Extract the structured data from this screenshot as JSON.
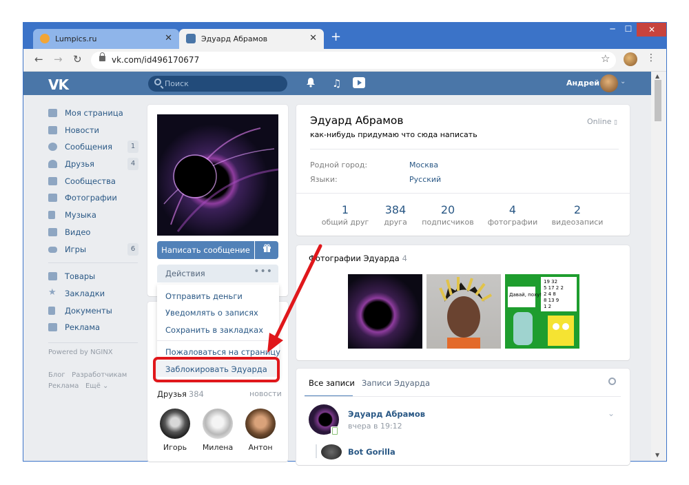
{
  "browser": {
    "tabs": [
      {
        "title": "Lumpics.ru",
        "close": "✕"
      },
      {
        "title": "Эдуард Абрамов",
        "close": "✕"
      }
    ],
    "new_tab": "+",
    "url": "vk.com/id496170677",
    "window_controls": [
      "─",
      "☐",
      "✕"
    ]
  },
  "vk_header": {
    "logo": "VK",
    "search_placeholder": "Поиск",
    "user_name": "Андрей"
  },
  "sidebar": {
    "items": [
      {
        "label": "Моя страница",
        "icon": "home-icon"
      },
      {
        "label": "Новости",
        "icon": "news-icon"
      },
      {
        "label": "Сообщения",
        "icon": "messages-icon",
        "count": "1"
      },
      {
        "label": "Друзья",
        "icon": "friends-icon",
        "count": "4"
      },
      {
        "label": "Сообщества",
        "icon": "groups-icon"
      },
      {
        "label": "Фотографии",
        "icon": "camera-icon"
      },
      {
        "label": "Музыка",
        "icon": "music-icon"
      },
      {
        "label": "Видео",
        "icon": "video-icon"
      },
      {
        "label": "Игры",
        "icon": "games-icon",
        "count": "6"
      }
    ],
    "items2": [
      {
        "label": "Товары",
        "icon": "bag-icon"
      },
      {
        "label": "Закладки",
        "icon": "star-icon"
      },
      {
        "label": "Документы",
        "icon": "document-icon"
      },
      {
        "label": "Реклама",
        "icon": "megaphone-icon"
      }
    ],
    "powered": "Powered by NGINX",
    "footer": {
      "blog": "Блог",
      "dev": "Разработчикам",
      "ads": "Реклама",
      "more": "Ещё ⌄"
    }
  },
  "profile_left": {
    "write_button": "Написать сообщение",
    "actions_button": "Действия",
    "actions_dots": "•••",
    "menu": [
      "Отправить деньги",
      "Уведомлять о записях",
      "Сохранить в закладках",
      "Пожаловаться на страницу",
      "Заблокировать Эдуарда"
    ],
    "friends_title": "Друзья",
    "friends_count": "384",
    "friends_new": "новости",
    "friends": [
      {
        "name": "Игорь"
      },
      {
        "name": "Милена"
      },
      {
        "name": "Антон"
      }
    ]
  },
  "profile": {
    "name": "Эдуард Абрамов",
    "status": "как-нибудь придумаю что сюда написать",
    "online": "Online",
    "info": [
      {
        "label": "Родной город:",
        "value": "Москва"
      },
      {
        "label": "Языки:",
        "value": "Русский"
      }
    ],
    "counters": [
      {
        "num": "1",
        "label": "общий друг"
      },
      {
        "num": "384",
        "label": "друга"
      },
      {
        "num": "20",
        "label": "подписчиков"
      },
      {
        "num": "4",
        "label": "фотографии"
      },
      {
        "num": "2",
        "label": "видеозаписи"
      }
    ]
  },
  "photos": {
    "title": "Фотографии Эдуарда",
    "count": "4",
    "meme_text": "Давай, поху!",
    "meme_numbers": "19 32\n5 17 2 2\n2 4 8\n8 13 9\n1 2"
  },
  "wall": {
    "tabs": [
      "Все записи",
      "Записи Эдуарда"
    ],
    "post": {
      "author": "Эдуард Абрамов",
      "time": "вчера в 19:12"
    },
    "reply": {
      "author": "Bot Gorilla"
    }
  },
  "colors": {
    "accent": "#4a76a8",
    "link": "#2a5885",
    "highlight": "#e0171b"
  }
}
